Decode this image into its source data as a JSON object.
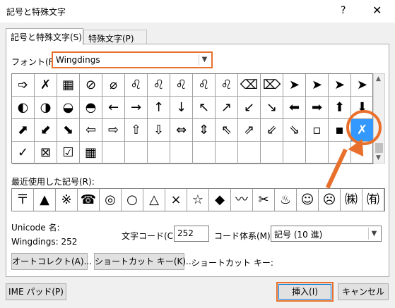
{
  "window": {
    "title": "記号と特殊文字",
    "help": "?",
    "close": "✕"
  },
  "tabs": [
    {
      "label": "記号と特殊文字(S)"
    },
    {
      "label": "特殊文字(P)"
    }
  ],
  "font": {
    "label": "フォント(F):",
    "value": "Wingdings"
  },
  "symbol_grid": [
    "➩",
    "✗",
    "▦",
    "⊘",
    "⌀",
    "♌",
    "♌",
    "♌",
    "♌",
    "♌",
    "⌫",
    "⌦",
    "➤",
    "➤",
    "➤",
    "➤",
    "◐",
    "◑",
    "◒",
    "◓",
    "←",
    "→",
    "↑",
    "↓",
    "↖",
    "↗",
    "↙",
    "↘",
    "⬅",
    "➡",
    "⬆",
    "⬇",
    "⬈",
    "⬋",
    "⬊",
    "⇦",
    "⇨",
    "⇧",
    "⇩",
    "⇔",
    "⇕",
    "⇖",
    "⇗",
    "⇙",
    "⇘",
    "▫",
    "▪",
    "✗",
    "✓",
    "⊠",
    "☑",
    "▦",
    "",
    "",
    "",
    "",
    "",
    "",
    "",
    "",
    "",
    "",
    "",
    ""
  ],
  "selected_index": 47,
  "recent": {
    "label": "最近使用した記号(R):",
    "items": [
      "〒",
      "▲",
      "※",
      "☎",
      "◎",
      "○",
      "△",
      "×",
      "☆",
      "◆",
      "〰",
      "✂",
      "♨",
      "☺",
      "☹",
      "㈱",
      "㈲"
    ]
  },
  "unicode": {
    "label": "Unicode 名:",
    "name": "Wingdings: 252"
  },
  "char_code": {
    "label": "文字コード(C):",
    "value": "252"
  },
  "code_system": {
    "label": "コード体系(M):",
    "value": "記号 (10 進)"
  },
  "buttons": {
    "autocorrect": "オートコレクト(A)...",
    "shortcut_key": "ショートカット キー(K)...",
    "shortcut_label": "ショートカット キー:",
    "ime_pad": "IME パッド(P)",
    "insert": "挿入(I)",
    "cancel": "キャンセル"
  },
  "colors": {
    "highlight": "#e8702c",
    "selection": "#3399ff"
  }
}
